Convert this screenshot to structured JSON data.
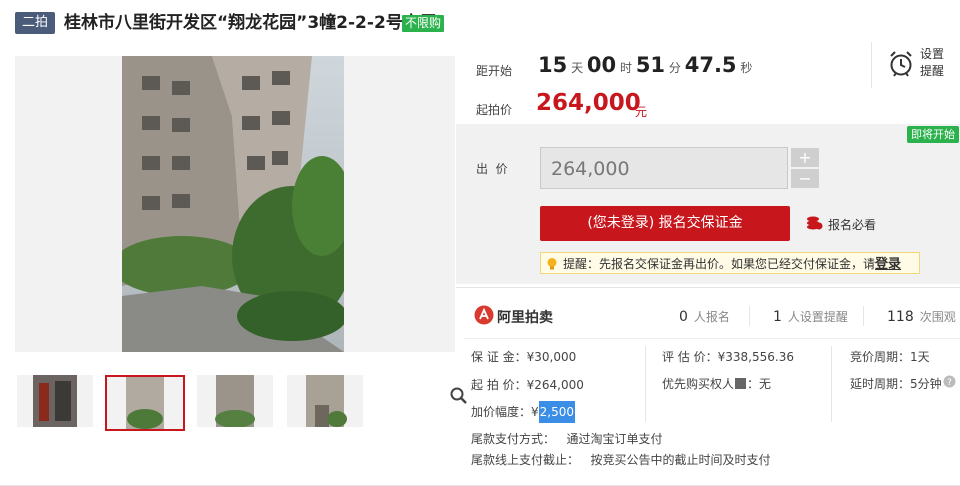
{
  "header": {
    "round_badge": "二拍",
    "title": "桂林市八里街开发区“翔龙花园”3幢2-2-2号房屋",
    "limit_badge": "不限购"
  },
  "countdown": {
    "label": "距开始",
    "days": "15",
    "days_unit": "天",
    "hours": "00",
    "hours_unit": "时",
    "minutes": "51",
    "minutes_unit": "分",
    "seconds": "47.5",
    "seconds_unit": "秒"
  },
  "reminder": {
    "line1": "设置",
    "line2": "提醒"
  },
  "start_price": {
    "label": "起拍价",
    "value": "264,000",
    "unit": "元"
  },
  "bid": {
    "soon_badge": "即将开始",
    "label": "出  价",
    "input_value": "264,000",
    "plus": "+",
    "minus": "−",
    "register_button": "(您未登录) 报名交保证金",
    "must_read": "报名必看",
    "notice_text": "提醒：先报名交保证金再出价。如果您已经交付保证金，请",
    "notice_login": "登录"
  },
  "platform": {
    "logo_text": "阿里拍卖"
  },
  "stats": [
    {
      "value": "0",
      "unit": "人报名"
    },
    {
      "value": "1",
      "unit": "人设置提醒"
    },
    {
      "value": "118",
      "unit": "次围观"
    }
  ],
  "details": {
    "deposit": "保 证 金：¥30,000",
    "start_price": "起 拍 价：¥264,000",
    "increment_label": "加价幅度：¥",
    "increment_value": "2,500",
    "appraisal": "评 估 价：¥338,556.36",
    "priority_label": "优先购买权人",
    "priority_value": "：无",
    "cycle": "竞价周期：1天",
    "extension": "延时周期：5分钟",
    "payment_method": "尾款支付方式：   通过淘宝订单支付",
    "payment_deadline": "尾款线上支付截止：   按竞买公告中的截止时间及时支付"
  },
  "colors": {
    "accent": "#c8161d",
    "green": "#2bb24c",
    "badge": "#4a5c7a"
  }
}
